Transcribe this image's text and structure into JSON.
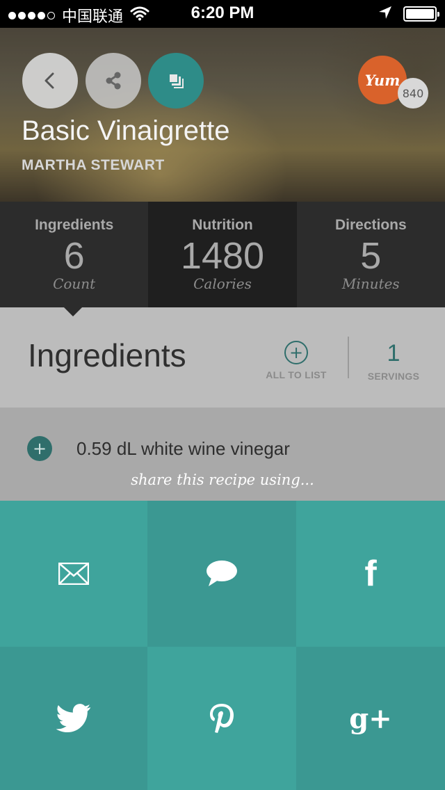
{
  "status_bar": {
    "carrier": "中国联通",
    "time": "6:20 PM",
    "icons": [
      "signal-dots",
      "wifi-icon",
      "location-arrow-icon",
      "battery-icon"
    ]
  },
  "header": {
    "title": "Basic Vinaigrette",
    "source": "MARTHA STEWART",
    "yum_label": "Yum",
    "yum_count": "840",
    "buttons": [
      "back-icon",
      "share-icon",
      "copy-icon"
    ]
  },
  "stats": [
    {
      "label": "Ingredients",
      "value": "6",
      "unit": "Count"
    },
    {
      "label": "Nutrition",
      "value": "1480",
      "unit": "Calories"
    },
    {
      "label": "Directions",
      "value": "5",
      "unit": "Minutes"
    }
  ],
  "ingredients_section": {
    "title": "Ingredients",
    "all_to_list_label": "ALL TO LIST",
    "plus_symbol": "+",
    "servings_value": "1",
    "servings_label": "SERVINGS"
  },
  "ingredients": [
    {
      "text": "0.59 dL white wine vinegar"
    }
  ],
  "share": {
    "caption": "share this recipe using...",
    "facebook_glyph": "f",
    "googleplus_glyph": "g+",
    "options": [
      "email-icon",
      "message-icon",
      "facebook-icon",
      "twitter-icon",
      "pinterest-icon",
      "google-plus-icon"
    ],
    "colors": {
      "primary": "#3fa49c",
      "secondary": "#3b9892"
    }
  }
}
